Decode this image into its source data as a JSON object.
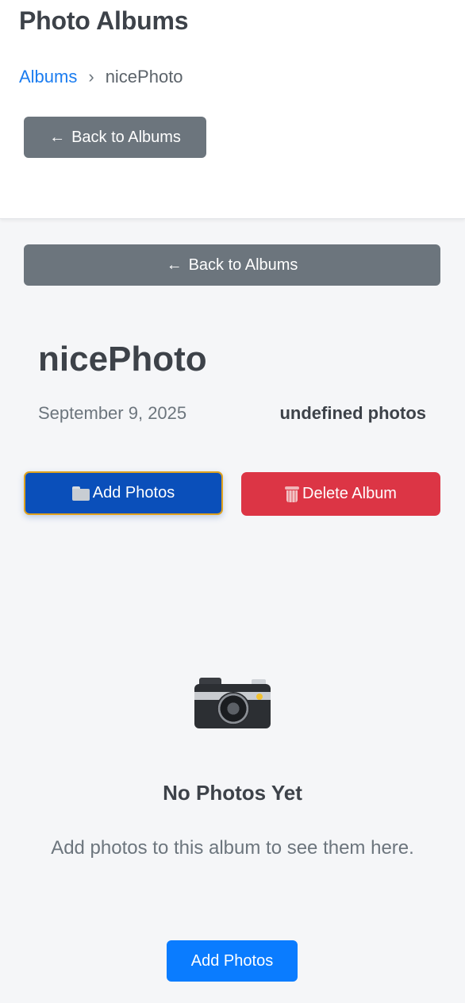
{
  "header": {
    "app_title": "Photo Albums",
    "breadcrumb": {
      "root": "Albums",
      "separator": "›",
      "current": "nicePhoto"
    },
    "back_button": "Back to Albums"
  },
  "main": {
    "back_button": "Back to Albums",
    "album": {
      "title": "nicePhoto",
      "date": "September 9, 2025",
      "photo_count": "undefined photos"
    },
    "actions": {
      "add_photos": "Add Photos",
      "delete_album": "Delete Album"
    },
    "empty_state": {
      "icon": "camera-icon",
      "title": "No Photos Yet",
      "description": "Add photos to this album to see them here.",
      "button": "Add Photos"
    }
  },
  "colors": {
    "primary": "#0a7cff",
    "primary_active": "#0a4fba",
    "danger": "#dc3545",
    "secondary": "#6c757d",
    "link": "#1a7cf0"
  }
}
